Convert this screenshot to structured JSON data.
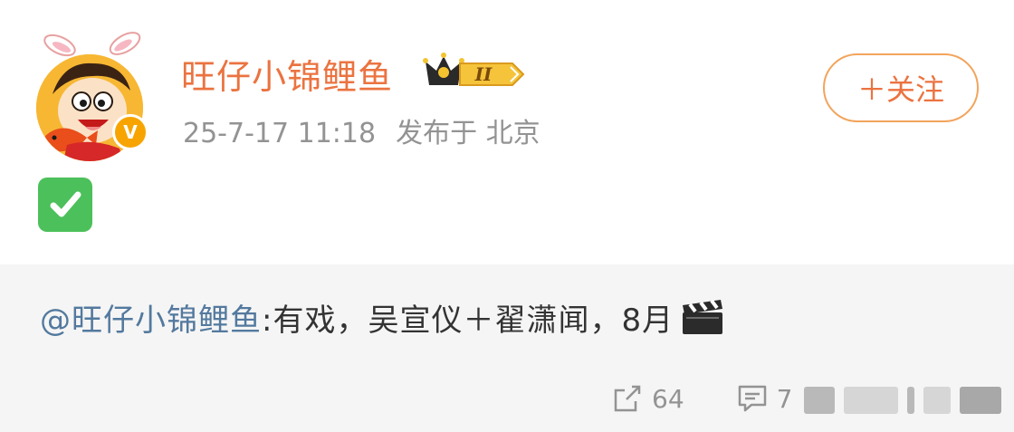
{
  "post": {
    "author": {
      "name": "旺仔小锦鲤鱼",
      "verified": true,
      "crown_level": "II"
    },
    "meta": {
      "timestamp": "25-7-17 11:18",
      "location": "发布于 北京"
    },
    "follow_label": "＋关注",
    "content_emoji": "white-check-mark",
    "repost": {
      "mention": "@旺仔小锦鲤鱼",
      "text": ":有戏，吴宣仪＋翟潇闻，8月",
      "trailing_emoji": "clapper-board"
    },
    "actions": {
      "share_count": "64",
      "comment_count": "7"
    },
    "colors": {
      "username": "#eb7340",
      "follow_border": "#f2a45c",
      "mention": "#53799e",
      "meta": "#939393",
      "repost_bg": "#f5f5f5",
      "check_green": "#4cc05a",
      "verified_badge": "#f7a400"
    }
  }
}
